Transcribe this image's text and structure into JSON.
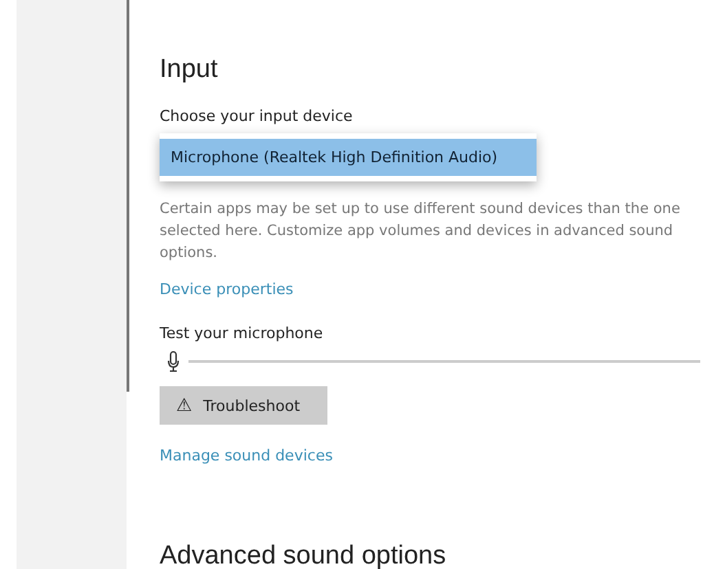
{
  "input": {
    "heading": "Input",
    "device_label": "Choose your input device",
    "device_options": [
      {
        "label": "Microphone (Realtek High Definition Audio)",
        "selected": true
      }
    ],
    "description": "Certain apps may be set up to use different sound devices than the one selected here. Customize app volumes and devices in advanced sound options.",
    "device_properties_link": "Device properties",
    "test_label": "Test your microphone",
    "troubleshoot_button": {
      "icon": "⚠",
      "label": "Troubleshoot"
    },
    "manage_link": "Manage sound devices"
  },
  "next_heading": "Advanced sound options"
}
